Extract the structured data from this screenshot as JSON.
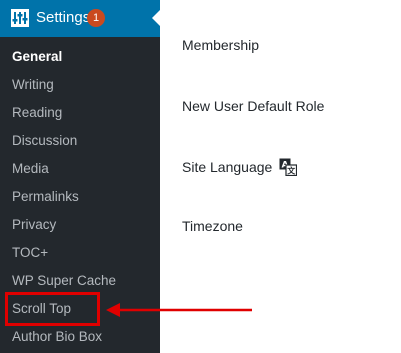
{
  "sidebar": {
    "header": {
      "label": "Settings",
      "badge": "1",
      "icon": "settings-sliders-icon"
    },
    "items": [
      {
        "label": "General",
        "active": true
      },
      {
        "label": "Writing",
        "active": false
      },
      {
        "label": "Reading",
        "active": false
      },
      {
        "label": "Discussion",
        "active": false
      },
      {
        "label": "Media",
        "active": false
      },
      {
        "label": "Permalinks",
        "active": false
      },
      {
        "label": "Privacy",
        "active": false
      },
      {
        "label": "TOC+",
        "active": false
      },
      {
        "label": "WP Super Cache",
        "active": false
      },
      {
        "label": "Scroll Top",
        "active": false,
        "highlighted": true
      },
      {
        "label": "Author Bio Box",
        "active": false
      }
    ]
  },
  "content": {
    "labels": {
      "membership": "Membership",
      "new_user_role": "New User Default Role",
      "site_language": "Site Language",
      "timezone": "Timezone"
    },
    "site_language_icon": "translation-icon"
  },
  "colors": {
    "sidebar_bg": "#23282d",
    "header_bg": "#0073aa",
    "badge_bg": "#ca4a1f",
    "highlight": "#e00000"
  }
}
